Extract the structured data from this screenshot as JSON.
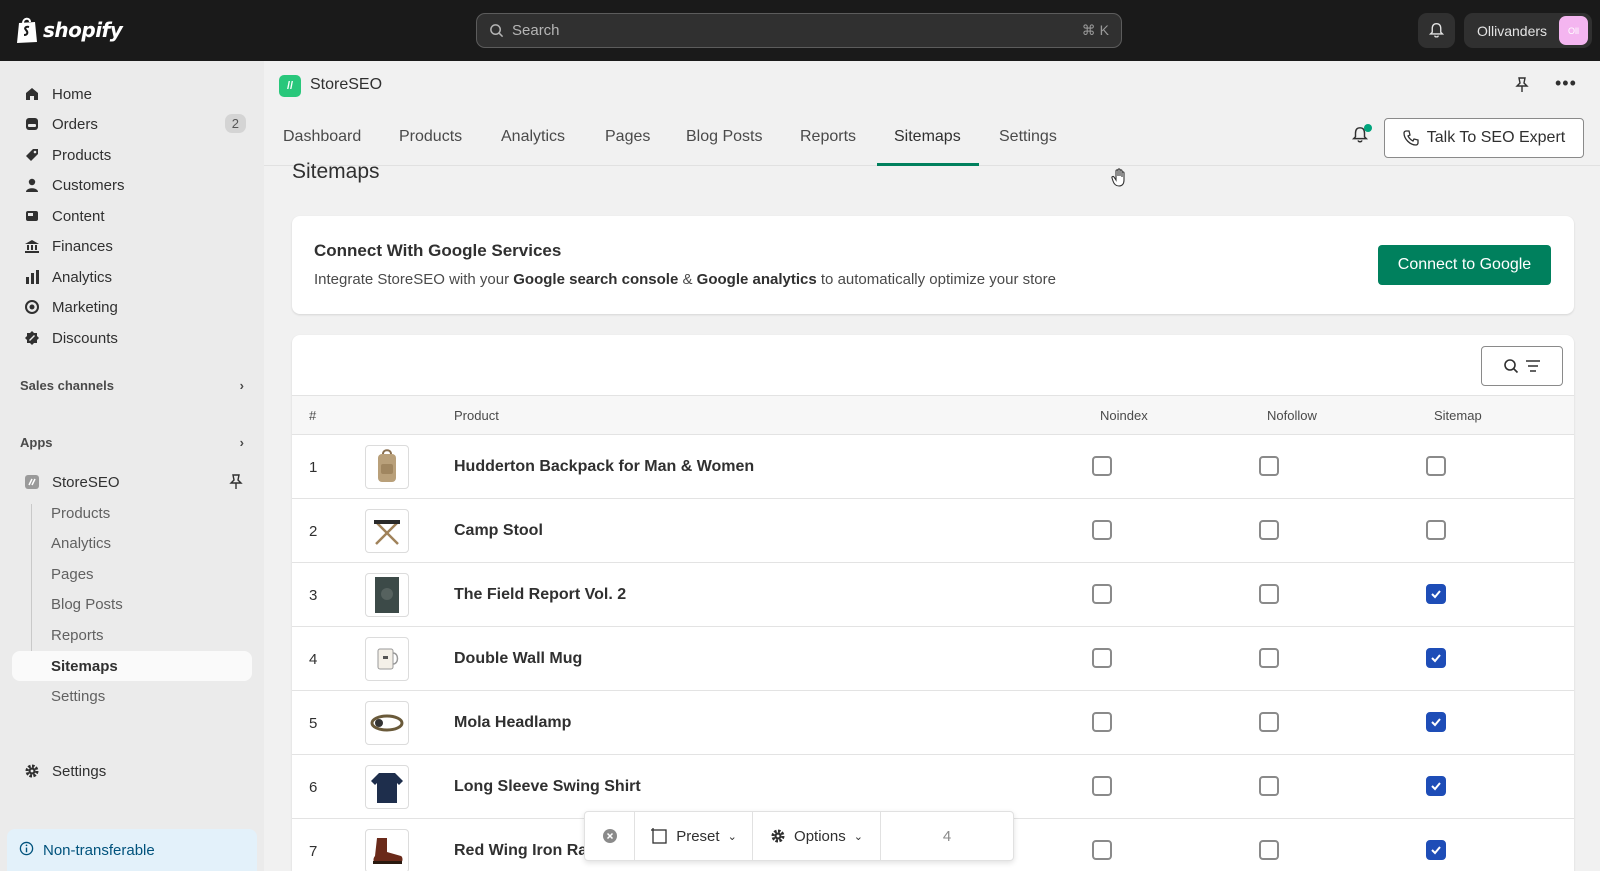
{
  "topbar": {
    "logo_text": "shopify",
    "search_placeholder": "Search",
    "search_shortcut": "⌘ K",
    "store_name": "Ollivanders",
    "avatar_initials": "Oll"
  },
  "sidebar": {
    "items": [
      {
        "label": "Home",
        "icon": "home-icon"
      },
      {
        "label": "Orders",
        "icon": "orders-icon",
        "badge": "2"
      },
      {
        "label": "Products",
        "icon": "tag-icon"
      },
      {
        "label": "Customers",
        "icon": "person-icon"
      },
      {
        "label": "Content",
        "icon": "content-icon"
      },
      {
        "label": "Finances",
        "icon": "bank-icon"
      },
      {
        "label": "Analytics",
        "icon": "bar-chart-icon"
      },
      {
        "label": "Marketing",
        "icon": "target-icon"
      },
      {
        "label": "Discounts",
        "icon": "discount-icon"
      }
    ],
    "sales_channels": "Sales channels",
    "apps": "Apps",
    "app_name": "StoreSEO",
    "app_subitems": [
      "Products",
      "Analytics",
      "Pages",
      "Blog Posts",
      "Reports",
      "Sitemaps",
      "Settings"
    ],
    "active_subitem": "Sitemaps",
    "settings": "Settings",
    "non_transferable": "Non-transferable"
  },
  "app_header": {
    "logo_mark": "//",
    "title": "StoreSEO"
  },
  "tabs": {
    "items": [
      "Dashboard",
      "Products",
      "Analytics",
      "Pages",
      "Blog Posts",
      "Reports",
      "Sitemaps",
      "Settings"
    ],
    "active": "Sitemaps",
    "talk_button": "Talk To SEO Expert"
  },
  "page": {
    "title": "Sitemaps"
  },
  "google_card": {
    "title": "Connect With Google Services",
    "desc_pre": "Integrate StoreSEO with your ",
    "desc_bold1": "Google search console",
    "desc_mid": " & ",
    "desc_bold2": "Google analytics",
    "desc_post": " to automatically optimize your store",
    "button": "Connect to Google"
  },
  "table": {
    "headers": {
      "num": "#",
      "product": "Product",
      "noindex": "Noindex",
      "nofollow": "Nofollow",
      "sitemap": "Sitemap"
    },
    "rows": [
      {
        "num": "1",
        "name": "Hudderton Backpack for Man & Women",
        "noindex": false,
        "nofollow": false,
        "sitemap": false
      },
      {
        "num": "2",
        "name": "Camp Stool",
        "noindex": false,
        "nofollow": false,
        "sitemap": false
      },
      {
        "num": "3",
        "name": "The Field Report Vol. 2",
        "noindex": false,
        "nofollow": false,
        "sitemap": true
      },
      {
        "num": "4",
        "name": "Double Wall Mug",
        "noindex": false,
        "nofollow": false,
        "sitemap": true
      },
      {
        "num": "5",
        "name": "Mola Headlamp",
        "noindex": false,
        "nofollow": false,
        "sitemap": true
      },
      {
        "num": "6",
        "name": "Long Sleeve Swing Shirt",
        "noindex": false,
        "nofollow": false,
        "sitemap": true
      },
      {
        "num": "7",
        "name": "Red Wing Iron Ra",
        "noindex": false,
        "nofollow": false,
        "sitemap": true
      }
    ]
  },
  "float_toolbar": {
    "preset": "Preset",
    "options": "Options",
    "value": "4"
  },
  "colors": {
    "primary": "#00805d",
    "checkbox_checked": "#1e4db7",
    "topbar": "#1a1a1a"
  }
}
